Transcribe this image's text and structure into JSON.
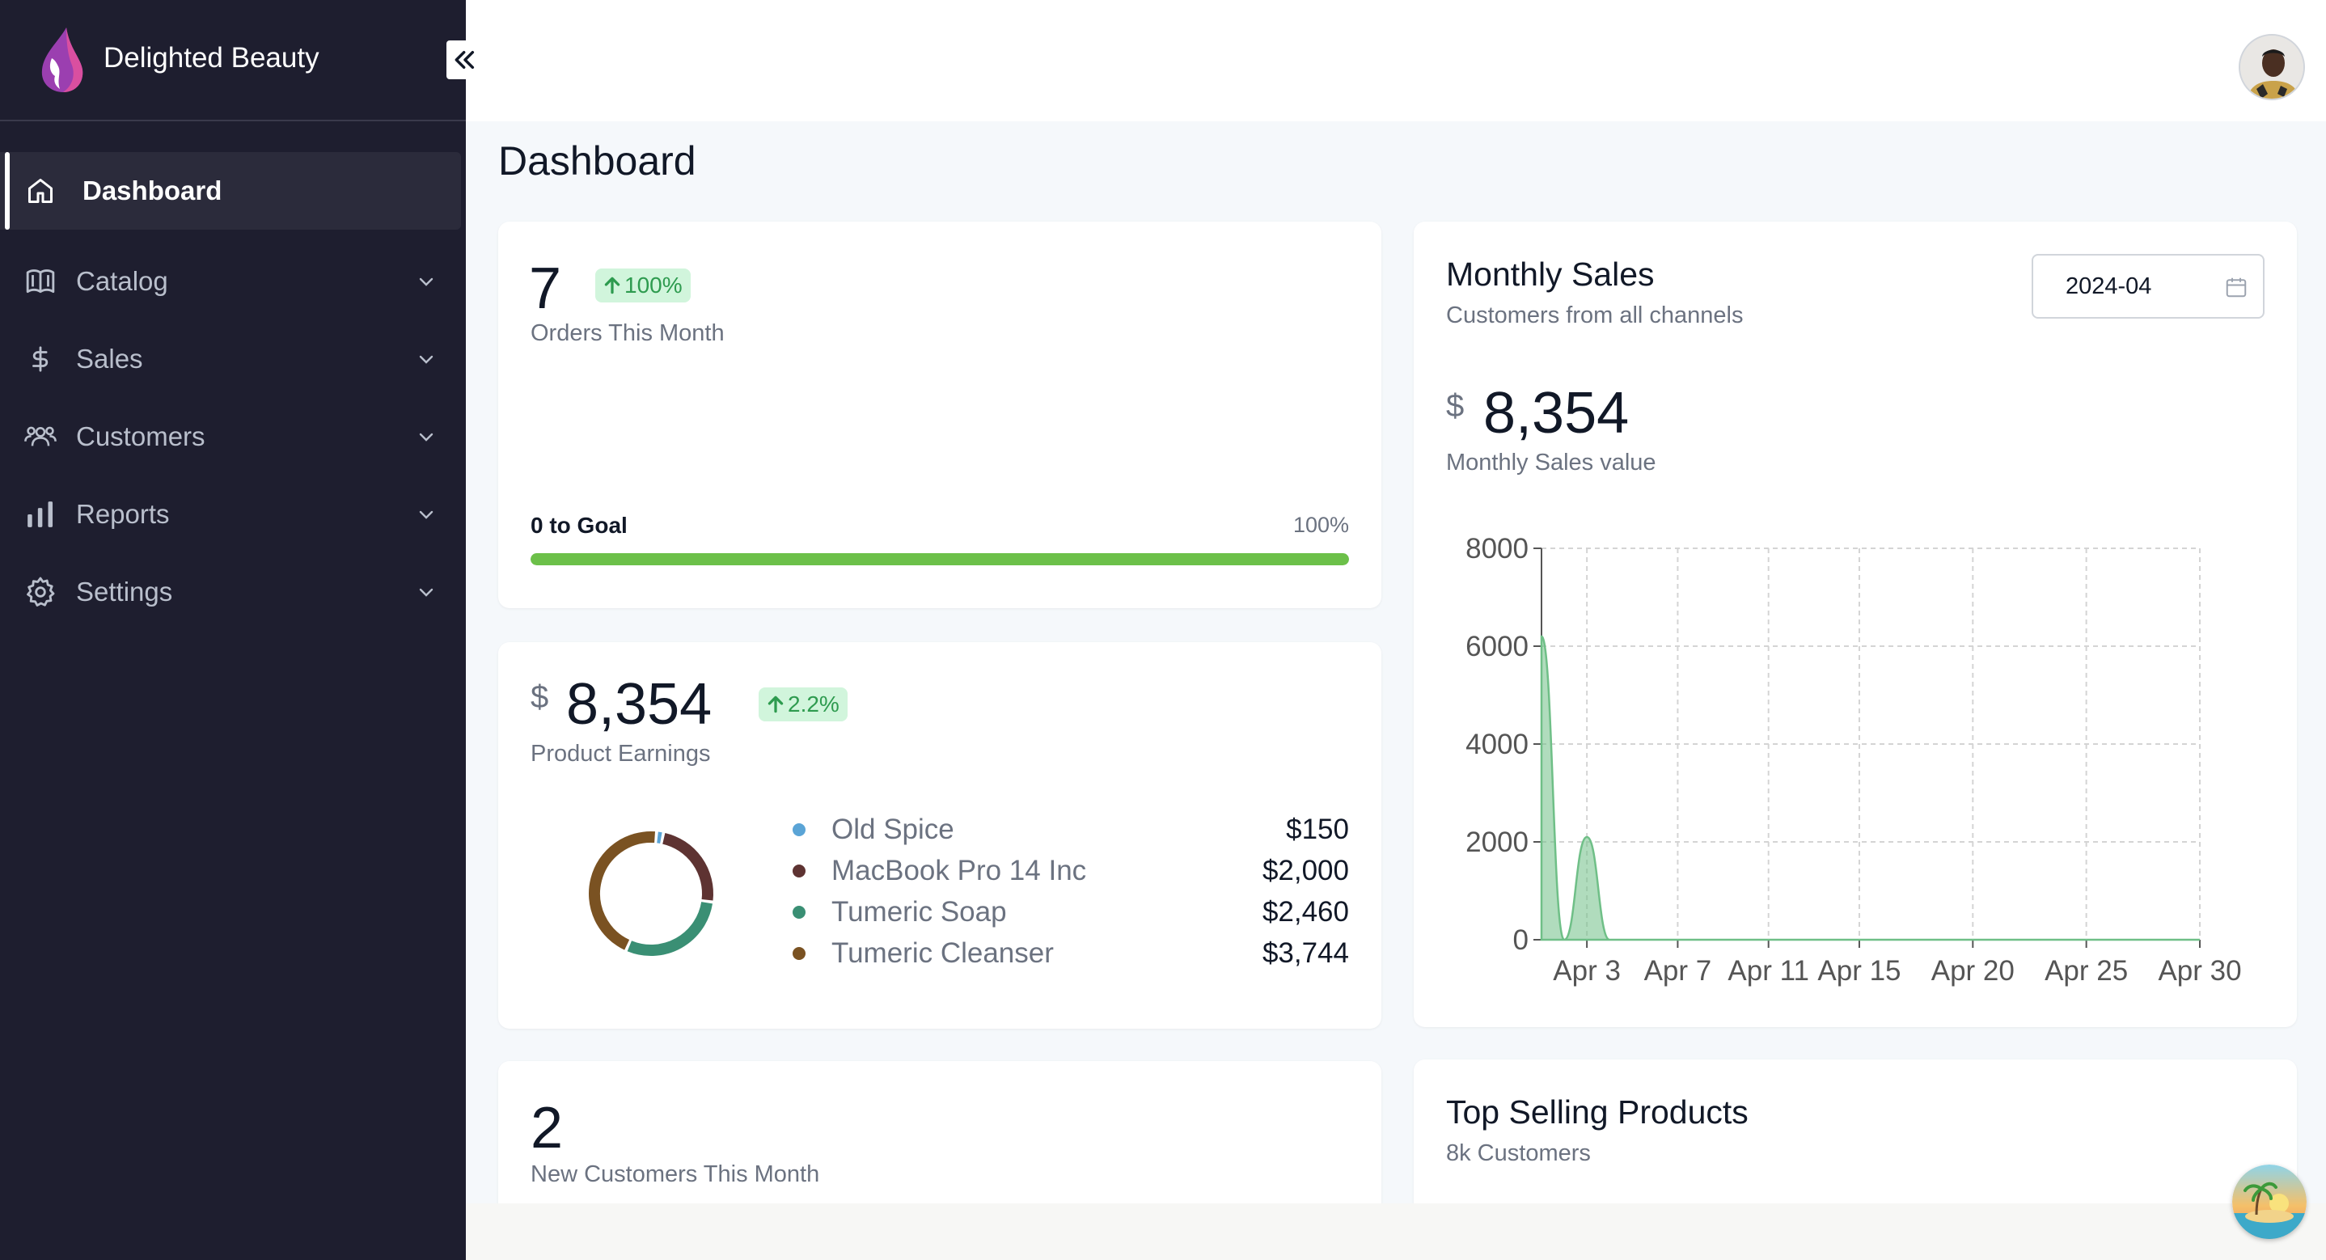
{
  "brand": {
    "name": "Delighted Beauty",
    "accent": "#8e3fa8"
  },
  "sidebar": {
    "items": [
      {
        "label": "Dashboard",
        "icon": "home-icon",
        "active": true
      },
      {
        "label": "Catalog",
        "icon": "book-icon"
      },
      {
        "label": "Sales",
        "icon": "dollar-icon"
      },
      {
        "label": "Customers",
        "icon": "users-icon"
      },
      {
        "label": "Reports",
        "icon": "bar-chart-icon"
      },
      {
        "label": "Settings",
        "icon": "gear-icon"
      }
    ]
  },
  "page": {
    "title": "Dashboard"
  },
  "orders_card": {
    "value": "7",
    "change": "100%",
    "label": "Orders This Month",
    "goal_label": "0 to Goal",
    "goal_pct": "100%",
    "progress": 1.0,
    "progress_color": "#6cc049"
  },
  "earnings_card": {
    "currency": "$",
    "value": "8,354",
    "change": "2.2%",
    "label": "Product Earnings",
    "products": [
      {
        "name": "Old Spice",
        "value": "$150",
        "color": "#5aa4d6",
        "amount": 150
      },
      {
        "name": "MacBook Pro 14 Inc",
        "value": "$2,000",
        "color": "#5e3332",
        "amount": 2000
      },
      {
        "name": "Tumeric Soap",
        "value": "$2,460",
        "color": "#3a8f74",
        "amount": 2460
      },
      {
        "name": "Tumeric Cleanser",
        "value": "$3,744",
        "color": "#7a5222",
        "amount": 3744
      }
    ]
  },
  "customers_card": {
    "value": "2",
    "label": "New Customers This Month"
  },
  "monthly_sales": {
    "title": "Monthly Sales",
    "subtitle": "Customers from all channels",
    "date_value": "2024-04",
    "currency": "$",
    "value": "8,354",
    "value_label": "Monthly Sales value"
  },
  "top_selling": {
    "title": "Top Selling Products",
    "subtitle": "8k Customers"
  },
  "chart_data": {
    "type": "area",
    "x": [
      1,
      2,
      3,
      4,
      5,
      6,
      7,
      8,
      9,
      10,
      11,
      12,
      13,
      14,
      15,
      16,
      17,
      18,
      19,
      20,
      21,
      22,
      23,
      24,
      25,
      26,
      27,
      28,
      29,
      30
    ],
    "series": [
      {
        "values": [
          6200,
          0,
          2100,
          0,
          0,
          0,
          0,
          0,
          0,
          0,
          0,
          0,
          0,
          0,
          0,
          0,
          0,
          0,
          0,
          0,
          0,
          0,
          0,
          0,
          0,
          0,
          0,
          0,
          0,
          0
        ],
        "color": "#6fbf87"
      }
    ],
    "x_tick_values": [
      3,
      7,
      11,
      15,
      20,
      25,
      30
    ],
    "x_tick_labels": [
      "Apr 3",
      "Apr 7",
      "Apr 11",
      "Apr 15",
      "Apr 20",
      "Apr 25",
      "Apr 30"
    ],
    "y_ticks": [
      0,
      2000,
      4000,
      6000,
      8000
    ],
    "ylim": [
      0,
      8000
    ],
    "xlim": [
      1,
      30
    ],
    "grid": true
  }
}
